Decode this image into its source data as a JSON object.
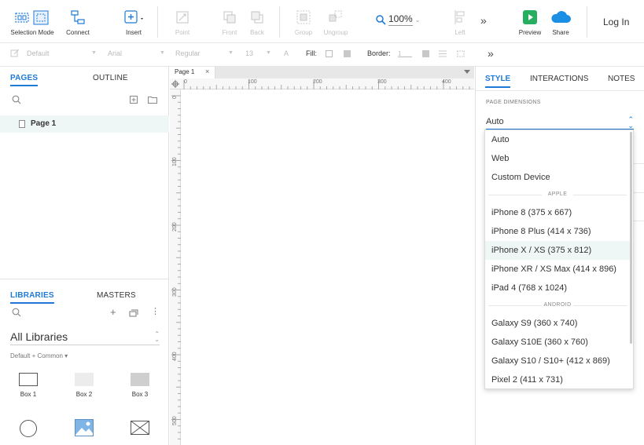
{
  "toolbar": {
    "selection_mode": "Selection Mode",
    "connect": "Connect",
    "insert": "Insert",
    "point": "Point",
    "front": "Front",
    "back": "Back",
    "group": "Group",
    "ungroup": "Ungroup",
    "zoom": "100%",
    "left": "Left",
    "preview": "Preview",
    "share": "Share",
    "login": "Log In"
  },
  "stylebar": {
    "style": "Default",
    "font": "Arial",
    "weight": "Regular",
    "size": "13",
    "font_color_icon": "A",
    "fill_label": "Fill:",
    "border_label": "Border:",
    "border_value": "1"
  },
  "left_panel": {
    "tabs": [
      "PAGES",
      "OUTLINE"
    ],
    "pages": [
      {
        "label": "Page 1"
      }
    ],
    "lib_tabs": [
      "LIBRARIES",
      "MASTERS"
    ],
    "library_select": "All Libraries",
    "library_sub": "Default + Common ▾",
    "widgets": [
      {
        "label": "Box 1",
        "icon": "box-outline"
      },
      {
        "label": "Box 2",
        "icon": "box-light"
      },
      {
        "label": "Box 3",
        "icon": "box-gray"
      }
    ]
  },
  "canvas": {
    "page_tab": "Page 1",
    "ruler_h": [
      "0",
      "100",
      "200",
      "300",
      "400"
    ],
    "ruler_v": [
      "0",
      "100",
      "200",
      "300",
      "400",
      "500"
    ]
  },
  "right_panel": {
    "tabs": [
      "STYLE",
      "INTERACTIONS",
      "NOTES"
    ],
    "page_dimensions_label": "PAGE DIMENSIONS",
    "page_dimensions_value": "Auto"
  },
  "dropdown": {
    "items_top": [
      "Auto",
      "Web",
      "Custom Device"
    ],
    "apple_header": "APPLE",
    "apple": [
      "iPhone 8  (375 x 667)",
      "iPhone 8 Plus  (414 x 736)",
      "iPhone X / XS  (375 x 812)",
      "iPhone XR / XS Max  (414 x 896)",
      "iPad 4  (768 x 1024)"
    ],
    "android_header": "ANDROID",
    "android": [
      "Galaxy S9  (360 x 740)",
      "Galaxy S10E  (360 x 760)",
      "Galaxy S10 / S10+  (412 x 869)",
      "Pixel 2  (411 x 731)"
    ],
    "highlighted": "iPhone X / XS  (375 x 812)"
  },
  "colors": {
    "accent": "#1d7ad6",
    "highlight": "#eef7f6",
    "preview_green": "#27ae60",
    "share_blue": "#1b8fe3"
  }
}
